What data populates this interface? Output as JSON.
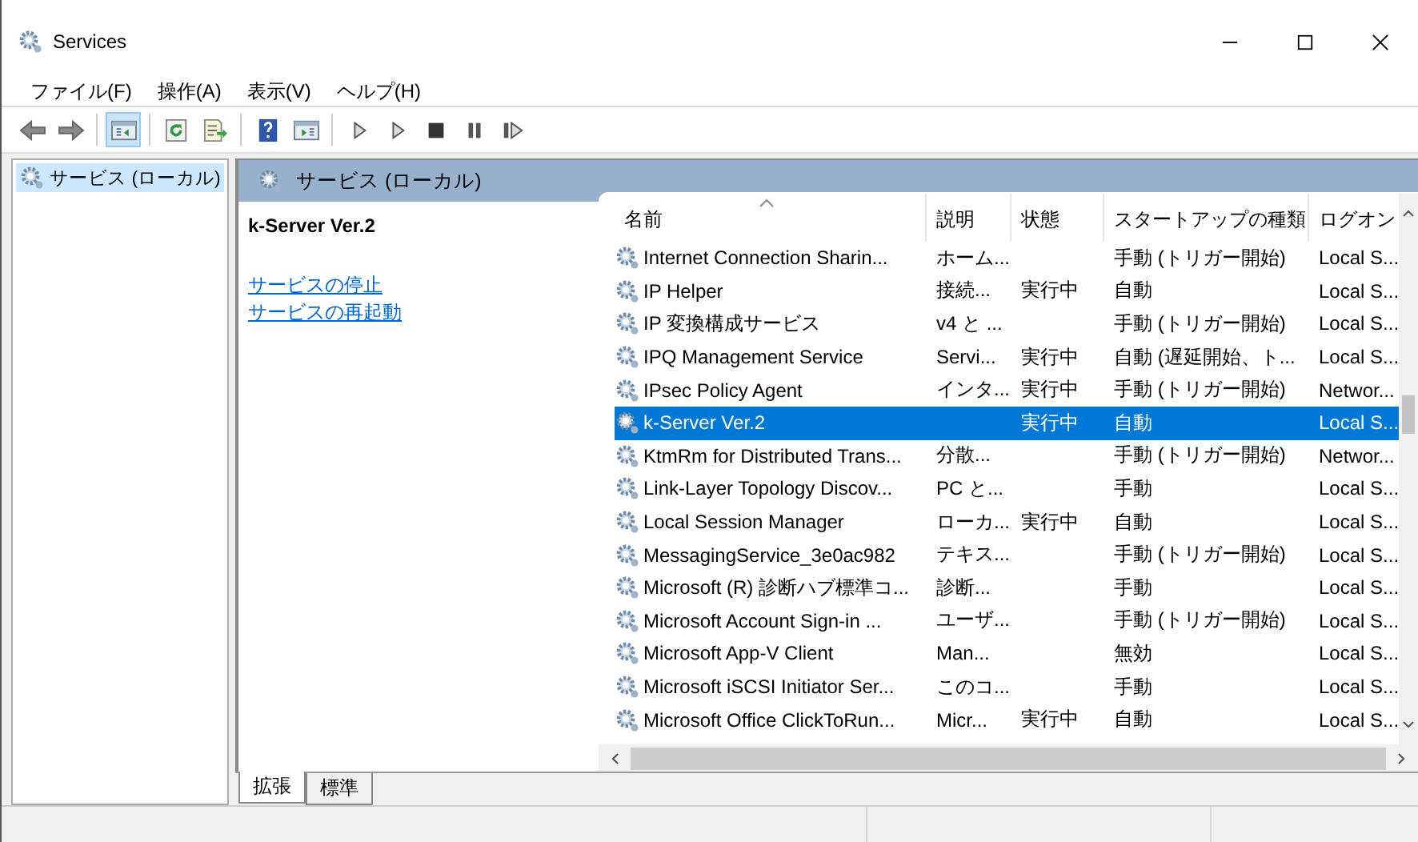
{
  "window": {
    "title": "Services"
  },
  "menu": [
    "ファイル(F)",
    "操作(A)",
    "表示(V)",
    "ヘルプ(H)"
  ],
  "toolbar": [
    {
      "kind": "back",
      "selected": false
    },
    {
      "kind": "forward",
      "selected": false
    },
    {
      "kind": "sep"
    },
    {
      "kind": "tree",
      "selected": true
    },
    {
      "kind": "sep"
    },
    {
      "kind": "refresh",
      "selected": false
    },
    {
      "kind": "export",
      "selected": false
    },
    {
      "kind": "sep"
    },
    {
      "kind": "help",
      "selected": false
    },
    {
      "kind": "view",
      "selected": false
    },
    {
      "kind": "sep"
    },
    {
      "kind": "play",
      "selected": false
    },
    {
      "kind": "play",
      "selected": false
    },
    {
      "kind": "stop",
      "selected": false
    },
    {
      "kind": "pause",
      "selected": false
    },
    {
      "kind": "resume",
      "selected": false
    }
  ],
  "tree": [
    {
      "label": "サービス (ローカル)",
      "selected": true
    }
  ],
  "panel": {
    "header": "サービス (ローカル)",
    "service_name": "k-Server Ver.2",
    "links": [
      "サービスの停止",
      "サービスの再起動"
    ]
  },
  "columns": [
    {
      "label": "名前",
      "sorted": true
    },
    {
      "label": "説明",
      "sorted": false
    },
    {
      "label": "状態",
      "sorted": false
    },
    {
      "label": "スタートアップの種類",
      "sorted": false
    },
    {
      "label": "ログオン",
      "sorted": false
    }
  ],
  "rows": [
    {
      "cells": [
        "Internet Connection Sharin...",
        "ホーム...",
        "",
        "手動 (トリガー開始)",
        "Local S..."
      ],
      "selected": false
    },
    {
      "cells": [
        "IP Helper",
        "接続...",
        "実行中",
        "自動",
        "Local S..."
      ],
      "selected": false
    },
    {
      "cells": [
        "IP 変換構成サービス",
        "v4 と ...",
        "",
        "手動 (トリガー開始)",
        "Local S..."
      ],
      "selected": false
    },
    {
      "cells": [
        "IPQ Management Service",
        "Servi...",
        "実行中",
        "自動 (遅延開始、ト...",
        "Local S..."
      ],
      "selected": false
    },
    {
      "cells": [
        "IPsec Policy Agent",
        "インタ...",
        "実行中",
        "手動 (トリガー開始)",
        "Networ..."
      ],
      "selected": false
    },
    {
      "cells": [
        "k-Server Ver.2",
        "",
        "実行中",
        "自動",
        "Local S..."
      ],
      "selected": true
    },
    {
      "cells": [
        "KtmRm for Distributed Trans...",
        "分散...",
        "",
        "手動 (トリガー開始)",
        "Networ..."
      ],
      "selected": false
    },
    {
      "cells": [
        "Link-Layer Topology Discov...",
        "PC と...",
        "",
        "手動",
        "Local S..."
      ],
      "selected": false
    },
    {
      "cells": [
        "Local Session Manager",
        "ローカ...",
        "実行中",
        "自動",
        "Local S..."
      ],
      "selected": false
    },
    {
      "cells": [
        "MessagingService_3e0ac982",
        "テキス...",
        "",
        "手動 (トリガー開始)",
        "Local S..."
      ],
      "selected": false
    },
    {
      "cells": [
        "Microsoft (R) 診断ハブ標準コ...",
        "診断...",
        "",
        "手動",
        "Local S..."
      ],
      "selected": false
    },
    {
      "cells": [
        "Microsoft Account Sign-in ...",
        "ユーザ...",
        "",
        "手動 (トリガー開始)",
        "Local S..."
      ],
      "selected": false
    },
    {
      "cells": [
        "Microsoft App-V Client",
        "Man...",
        "",
        "無効",
        "Local S..."
      ],
      "selected": false
    },
    {
      "cells": [
        "Microsoft iSCSI Initiator Ser...",
        "このコ...",
        "",
        "手動",
        "Local S..."
      ],
      "selected": false
    },
    {
      "cells": [
        "Microsoft Office ClickToRun...",
        "Micr...",
        "実行中",
        "自動",
        "Local S..."
      ],
      "selected": false
    }
  ],
  "tabs": [
    {
      "label": "拡張",
      "selected": true
    },
    {
      "label": "標準",
      "selected": false
    }
  ]
}
